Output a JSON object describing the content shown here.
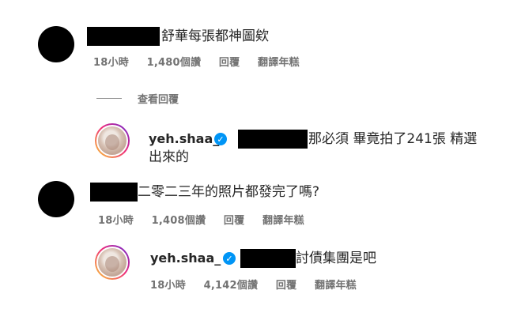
{
  "comments": [
    {
      "text": "舒華每張都神圖欸",
      "meta": {
        "time": "18小時",
        "views": "1,480個讚",
        "reply": "回覆",
        "translate": "翻譯年糕"
      }
    },
    {
      "text": "二零二三年的照片都發完了嗎?",
      "meta": {
        "time": "18小時",
        "views": "1,408個讚",
        "reply": "回覆",
        "translate": "翻譯年糕"
      }
    }
  ],
  "view_replies": "查看回覆",
  "replies": [
    {
      "username": "yeh.shaa_",
      "text_line1": "那必須 畢竟拍了241張 精選",
      "text_line2": "出來的"
    },
    {
      "username": "yeh.shaa_",
      "text": "討債集團是吧",
      "meta": {
        "time": "18小時",
        "views": "4,142個讚",
        "reply": "回覆",
        "translate": "翻譯年糕"
      }
    }
  ],
  "icons": {
    "verified": "verified-badge-icon"
  },
  "colors": {
    "verified": "#0095f6",
    "meta": "#737373"
  }
}
